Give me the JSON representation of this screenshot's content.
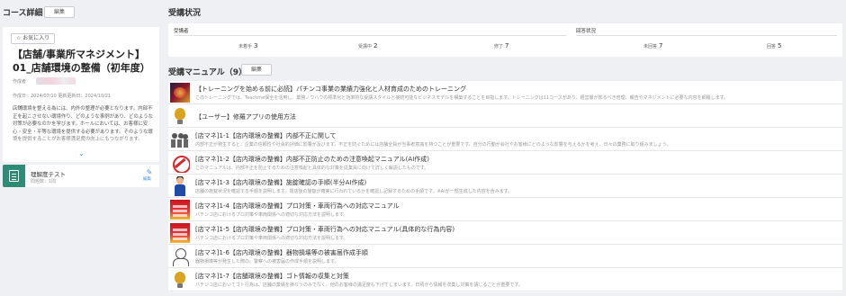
{
  "left": {
    "header": "コース詳細",
    "edit_label": "編集",
    "favorite_label": "☆ お気に入り",
    "course_title": "【店舗/事業所マネジメント】01_店舗環境の整備（初年度）",
    "creator_label": "作成者",
    "meta": "作成日：2024/07/10  更新更新日：2024/10/21",
    "description": "店舗環境を整える為には、内外の整理が必要となります。内部不正を起こさせない環境作り、どのような事例があり、どのような対策が必要なのかを学びます。ホールにおいては、お客様に安心・安全・平等な環境を提供する必要があります。そのような環境を提供することがお客様満足度の向上にもつながります。",
    "test": {
      "name": "理解度テスト",
      "meta": "問題数：1問",
      "edit_label": "編集"
    }
  },
  "right": {
    "status_header": "受講状況",
    "attendees": {
      "label": "受講者",
      "not_started_label": "未着手",
      "not_started": "3",
      "in_progress_label": "受講中",
      "in_progress": "2",
      "done_label": "修了",
      "done": "7"
    },
    "survey": {
      "label": "回答状況",
      "unanswered_label": "未回答",
      "unanswered": "7",
      "answered_label": "回答",
      "answered": "5"
    },
    "manual_header": "受講マニュアル（9）",
    "edit_label": "編集",
    "manuals": [
      {
        "title": "【トレーニングを始める前に必読】パチンコ事業の業績力強化と人材育成のためのトレーニング",
        "desc": "このトレーニングでは、Teachme保全を活用し、業務ノウハウの標準化と効率的な受講スタイルと接続可能なビジネスモデルを構築することを目指します。トレーニングは11コースがあり、経営層が知るべき管理、報告やマネジメントに必要な内容を網羅します。"
      },
      {
        "title": "【ユーザー】修羅アプリの使用方法",
        "desc": ""
      },
      {
        "title": "[店マネ]1-1【店内環境の整備】内部不正に関して",
        "desc": "内部不正が発生すると、企業の信頼性や社会的評価に影響が及びます。不正を防ぐためには店舗全員が当事者意識を持つことが重要です。自分の行動が会社やお客様にどのような影響を与えるかを考え、日々の業務に取り組みましょう。"
      },
      {
        "title": "[店マネ]1-2【店内環境の整備】内部不正防止のための注意喚起マニュアル(AI作成)",
        "desc": "このマニュアルは、内部不正を防止するための注意喚起と具体的な対策を従業員に向けて詳しく解説したものです。"
      },
      {
        "title": "[店マネ]1-3【店内環境の整備】施錠確認の手順(半分AI作成)",
        "desc": "店舗の施錠状況を確認する手順を説明します。閉店後の施錠が確実に行われているかを確認し記録するための手順です。※AIが一部生成した内容を含みます。"
      },
      {
        "title": "[店マネ]1-4【店内環境の整備】プロ対策・車両行為への対応マニュアル",
        "desc": "パチンコ店におけるプロ対策や車両関係への適切な対応方法を説明します。"
      },
      {
        "title": "[店マネ]1-5【店内環境の整備】プロ対策・車両行為への対応マニュアル(具体的な行為内容)",
        "desc": "パチンコ店におけるプロ対策や車両関係への適切な対応方法を説明します。"
      },
      {
        "title": "[店マネ]1-6【店内環境の整備】器物損壊等の被害届作成手順",
        "desc": "器物損壊等が発生した際の、警察への被害届の作成手順を説明します。"
      },
      {
        "title": "[店マネ]1-7【店舗環境の整備】ゴト情報の収集と対策",
        "desc": "パチンコ店においてゴト行為は、店舗の業績を損なうのみでなく、他のお客様の満足度も下げてしまいます。日頃から情報を収集し対策を講じることが重要です。"
      }
    ]
  },
  "colors": {
    "accent": "#4a90d9",
    "test_icon": "#2e8b74",
    "background": "#eef0f3"
  },
  "icons": [
    "star-icon",
    "chevron-down-icon",
    "document-icon",
    "edit-icon"
  ]
}
